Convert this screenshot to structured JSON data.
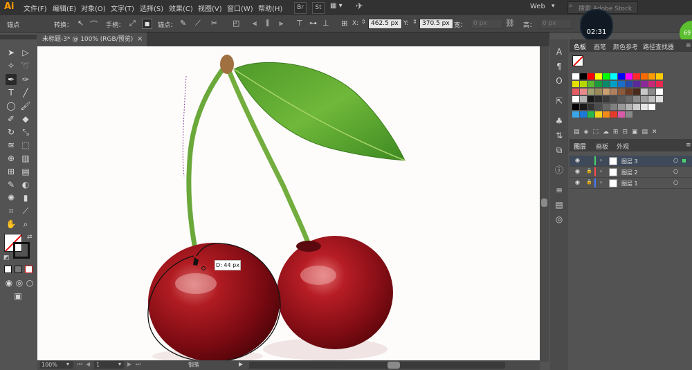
{
  "menubar": {
    "logo": "Ai",
    "items": [
      "文件(F)",
      "编辑(E)",
      "对象(O)",
      "文字(T)",
      "选择(S)",
      "效果(C)",
      "视图(V)",
      "窗口(W)",
      "帮助(H)"
    ],
    "btn_br": "Br",
    "btn_st": "St",
    "workspace": "Web",
    "search_placeholder": "搜索 Adobe Stock"
  },
  "controlbar": {
    "anchor_label": "锚点",
    "convert_label": "转换：",
    "handle_label": "手柄：",
    "anchor2_label": "锚点：",
    "x_label": "X:",
    "x_value": "462.5 px",
    "y_label": "Y:",
    "y_value": "370.5 px",
    "w_label": "宽：",
    "w_value": "0 px",
    "h_label": "高：",
    "h_value": "0 px"
  },
  "timer": "02:31",
  "badge": "69",
  "document_tab": {
    "title": "未标题-3* @ 100% (RGB/预览)",
    "close": "×"
  },
  "canvas": {
    "measure_label": "D: 44 px"
  },
  "statusbar": {
    "zoom": "100%",
    "page": "1",
    "tool_name": "钢笔"
  },
  "swatches_panel": {
    "tabs": [
      "色板",
      "画笔",
      "颜色参考",
      "路径查找器"
    ],
    "colors": [
      [
        "#ffffff",
        "#000000",
        "#ff0000",
        "#ffff00",
        "#00ff00",
        "#00ffff",
        "#0000ff",
        "#ff00ff",
        "#ff2a2a",
        "#ff6a00",
        "#ff9a00",
        "#ffcc00"
      ],
      [
        "#e5e100",
        "#b5d600",
        "#5ab62d",
        "#1a9a3c",
        "#0a8a6a",
        "#00a0c6",
        "#1a6ec8",
        "#2a4aa8",
        "#5a2a98",
        "#8a2a98",
        "#c8287a",
        "#e82850"
      ],
      [
        "#e65a64",
        "#e68a8a",
        "#a0a070",
        "#9a8a5a",
        "#c8a070",
        "#b08060",
        "#8a5a3a",
        "#6a3a22",
        "#4a2a1a",
        "#c8c8c8",
        "#8a8a8a",
        "#ffffff"
      ],
      [
        "#ffffff",
        "#b4b4b4",
        "#1a1a1a",
        "#2b2b2b",
        "#3a3a3a",
        "#4a4a4a",
        "#5a5a5a",
        "#6a6a6a",
        "#8a8a8a",
        "#a0a0a0",
        "#c0c0c0",
        "#e0e0e0"
      ],
      [
        "#000000",
        "#1a1a1a",
        "#333333",
        "#4d4d4d",
        "#666666",
        "#808080",
        "#999999",
        "#b3b3b3",
        "#cccccc",
        "#e6e6e6",
        "#ffffff",
        "#535353"
      ],
      [
        "#3aa6e8",
        "#1c7ad6",
        "#2ab84a",
        "#f2d21a",
        "#f28a1a",
        "#e83a2a",
        "#d85aa8",
        "#888888",
        "#535353",
        "#535353",
        "#535353",
        "#535353"
      ]
    ]
  },
  "layers_panel": {
    "tabs": [
      "图层",
      "画板",
      "外观"
    ],
    "layers": [
      {
        "name": "图层 3",
        "color": "#4bd26b"
      },
      {
        "name": "图层 2",
        "color": "#ff4a4a"
      },
      {
        "name": "图层 1",
        "color": "#4a7bff"
      }
    ]
  }
}
